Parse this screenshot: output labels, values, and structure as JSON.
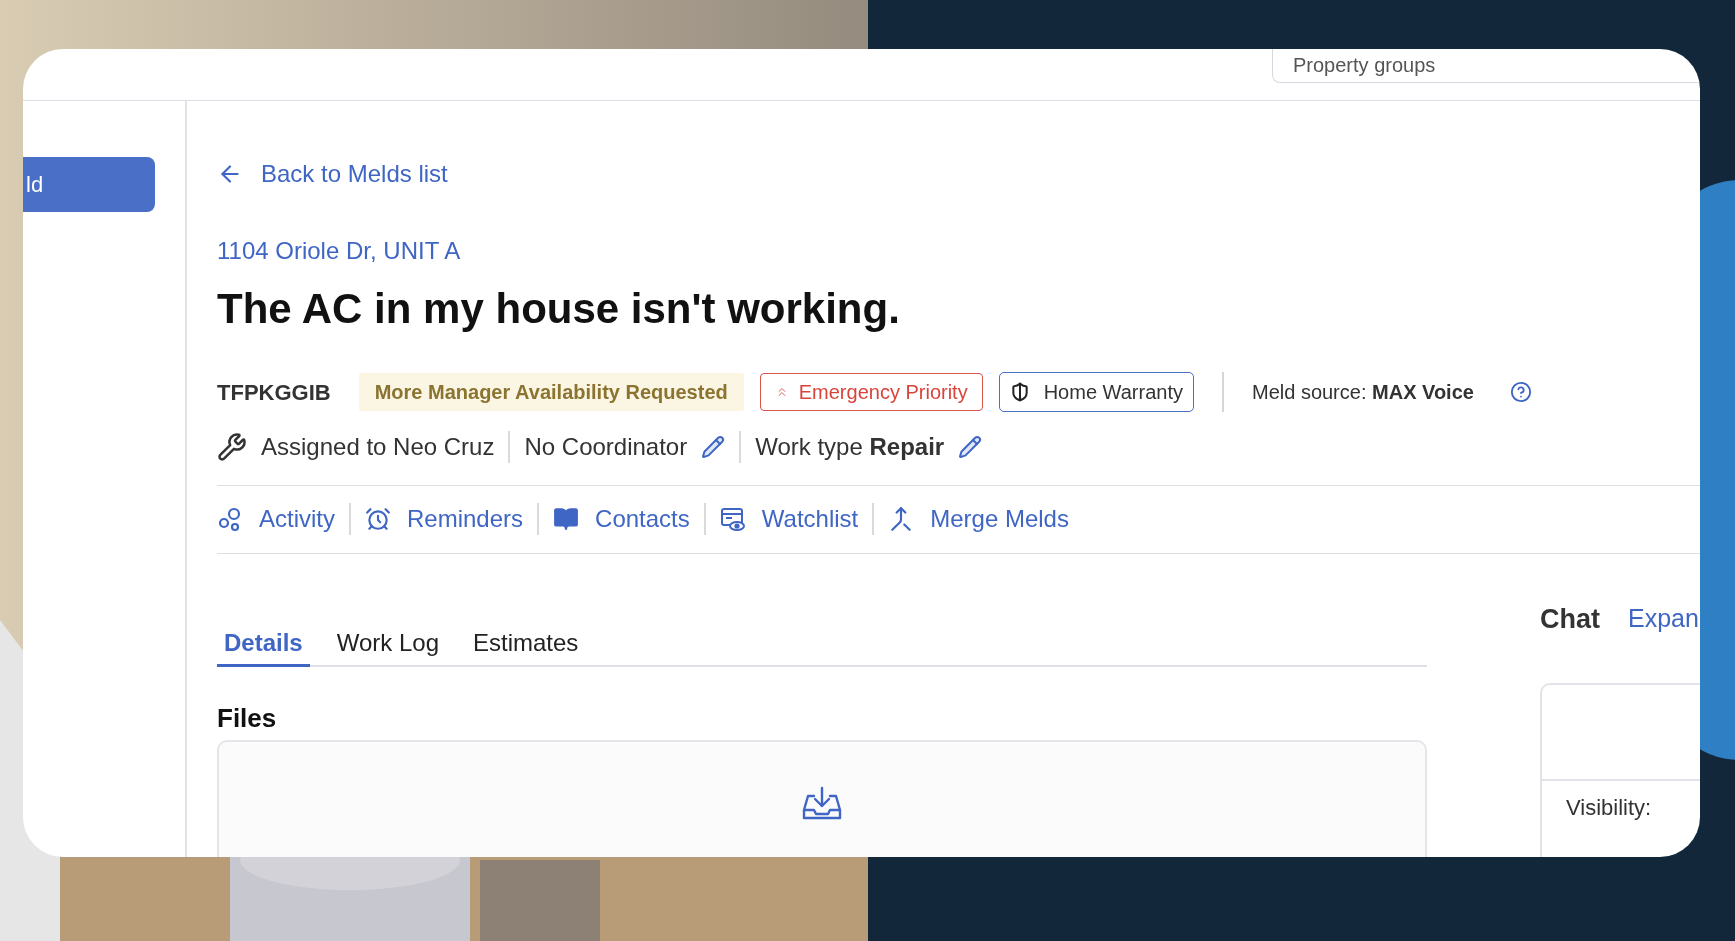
{
  "header": {
    "property_groups_field": "Property groups"
  },
  "sidebar": {
    "button": "ld"
  },
  "back_link": "Back to Melds list",
  "address": "1104 Oriole Dr, UNIT A",
  "title": "The AC in my house isn't working.",
  "meld_id": "TFPKGGIB",
  "badges": [
    {
      "kind": "status",
      "label": "More Manager Availability Requested"
    },
    {
      "kind": "priority",
      "label": "Emergency Priority"
    },
    {
      "kind": "warranty",
      "label": "Home Warranty"
    }
  ],
  "meld_source": "Meld source: **MAX Voice**",
  "assignment": [
    {
      "kind": "assignee",
      "text": "Assigned to Neo Cruz",
      "editable": false
    },
    {
      "kind": "coordinator",
      "text": "No Coordinator",
      "editable": true
    },
    {
      "kind": "work_type",
      "text": "Work type **Repair**",
      "editable": true
    }
  ],
  "actions": [
    {
      "kind": "activity",
      "label": "Activity"
    },
    {
      "kind": "reminders",
      "label": "Reminders"
    },
    {
      "kind": "contacts",
      "label": "Contacts"
    },
    {
      "kind": "watchlist",
      "label": "Watchlist"
    },
    {
      "kind": "merge",
      "label": "Merge Melds"
    }
  ],
  "tabs": [
    {
      "label": "Details",
      "selected": true
    },
    {
      "label": "Work Log",
      "selected": false
    },
    {
      "label": "Estimates",
      "selected": false
    }
  ],
  "files": {
    "title": "Files"
  },
  "chat": {
    "title": "Chat",
    "expand_link": "Expan",
    "visibility_label": "Visibility:"
  }
}
